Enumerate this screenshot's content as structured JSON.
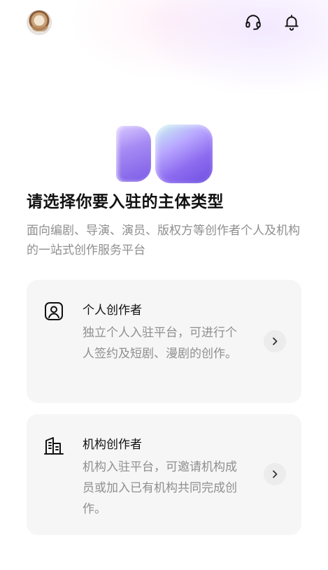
{
  "topbar": {
    "avatar": "avatar",
    "support_icon": "headset-icon",
    "notification_icon": "bell-icon"
  },
  "hero": {
    "logo_icon": "app-logo",
    "title": "请选择你要入驻的主体类型",
    "subtitle": "面向编剧、导演、演员、版权方等创作者个人及机构的一站式创作服务平台"
  },
  "options": [
    {
      "icon": "person-icon",
      "title": "个人创作者",
      "description": "独立个人入驻平台，可进行个人签约及短剧、漫剧的创作。",
      "arrow_icon": "chevron-right-icon"
    },
    {
      "icon": "building-icon",
      "title": "机构创作者",
      "description": "机构入驻平台，可邀请机构成员或加入已有机构共同完成创作。",
      "arrow_icon": "chevron-right-icon"
    }
  ],
  "colors": {
    "text_primary": "#111111",
    "text_secondary": "#8f8f8f",
    "card_background": "#f6f6f6",
    "logo_purple": "#7b5ce6"
  }
}
